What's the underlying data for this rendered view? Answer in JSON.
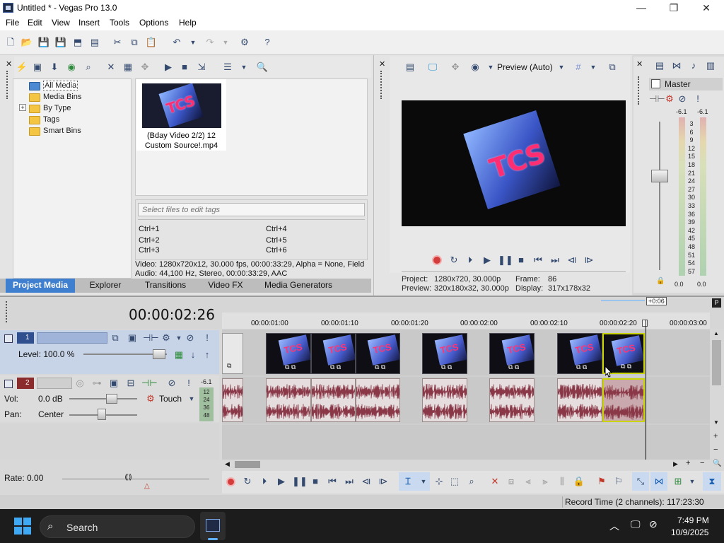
{
  "window": {
    "title": "Untitled * - Vegas Pro 13.0",
    "minimize": "—",
    "maximize": "❐",
    "close": "✕"
  },
  "menu": [
    "File",
    "Edit",
    "View",
    "Insert",
    "Tools",
    "Options",
    "Help"
  ],
  "project_media": {
    "tree": [
      "All Media",
      "Media Bins",
      "By Type",
      "Tags",
      "Smart Bins"
    ],
    "tree_expander": "+",
    "thumb_caption_line1": "(Bday Video 2/2) 12",
    "thumb_caption_line2": "Custom Source!.mp4",
    "thumb_text": "TCS",
    "tags_placeholder": "Select files to edit tags",
    "shortcuts": [
      "Ctrl+1",
      "Ctrl+4",
      "Ctrl+2",
      "Ctrl+5",
      "Ctrl+3",
      "Ctrl+6"
    ],
    "info_line1": "Video: 1280x720x12, 30.000 fps, 00:00:33:29, Alpha = None, Field",
    "info_line2": "Audio: 44,100 Hz, Stereo, 00:00:33:29, AAC"
  },
  "dock_tabs": [
    "Project Media",
    "Explorer",
    "Transitions",
    "Video FX",
    "Media Generators"
  ],
  "preview": {
    "quality": "Preview (Auto)",
    "project_label": "Project:",
    "project_value": "1280x720, 30.000p",
    "preview_label": "Preview:",
    "preview_value": "320x180x32, 30.000p",
    "frame_label": "Frame:",
    "frame_value": "86",
    "display_label": "Display:",
    "display_value": "317x178x32",
    "screen_text": "TCS"
  },
  "master": {
    "title": "Master",
    "peak_left": "-6.1",
    "peak_right": "-6.1",
    "scale": [
      "3",
      "6",
      "9",
      "12",
      "15",
      "18",
      "21",
      "24",
      "27",
      "30",
      "33",
      "36",
      "39",
      "42",
      "45",
      "48",
      "51",
      "54",
      "57"
    ],
    "fader_left": "0.0",
    "fader_right": "0.0"
  },
  "timeline": {
    "cursor_time": "00:00:02:26",
    "loop_marker": "+0:06",
    "ruler": [
      "00:00:01:00",
      "00:00:01:10",
      "00:00:01:20",
      "00:00:02:00",
      "00:00:02:10",
      "00:00:02:20",
      "00:00:03:00"
    ],
    "track1": {
      "number": "1",
      "level": "Level: 100.0 %"
    },
    "track2": {
      "number": "2",
      "vol_label": "Vol:",
      "vol_value": "0.0 dB",
      "pan_label": "Pan:",
      "pan_value": "Center",
      "automation": "Touch",
      "meter_peak": "-6.1",
      "meter_scale": [
        "12",
        "24",
        "36",
        "48"
      ]
    },
    "rate": "Rate: 0.00"
  },
  "status": {
    "record_time": "Record Time (2 channels): 117:23:30"
  },
  "taskbar": {
    "search": "Search",
    "time": "7:49 PM",
    "date": "10/9/2025"
  }
}
